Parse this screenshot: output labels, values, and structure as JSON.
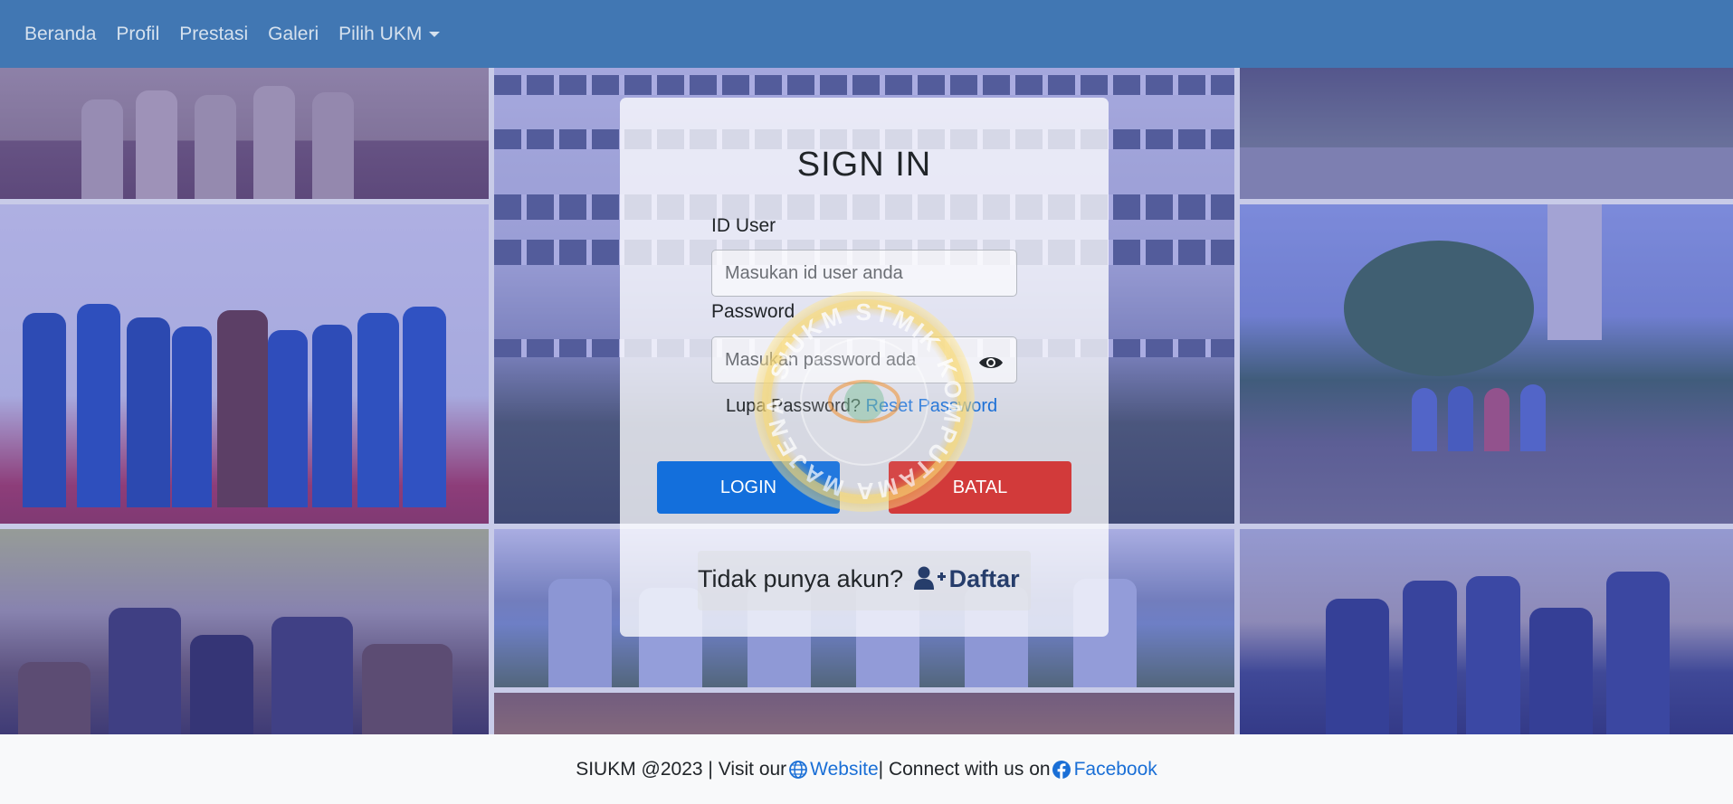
{
  "nav": {
    "items": [
      {
        "label": "Beranda"
      },
      {
        "label": "Profil"
      },
      {
        "label": "Prestasi"
      },
      {
        "label": "Galeri"
      },
      {
        "label": "Pilih UKM"
      }
    ]
  },
  "logo": {
    "text": "SIUKM STMIK KOMPUTAMA MAJENANG"
  },
  "login": {
    "title": "SIGN IN",
    "id_label": "ID User",
    "id_placeholder": "Masukan id user anda",
    "password_label": "Password",
    "password_placeholder": "Masukan password ada",
    "forgot_text": "Lupa Password?",
    "reset_link": "Reset Password",
    "login_button": "LOGIN",
    "cancel_button": "BATAL",
    "no_account_text": "Tidak punya akun?",
    "register_link": "Daftar"
  },
  "footer": {
    "copyright": "SIUKM @2023 | Visit our",
    "website_link": "Website",
    "connect_text": "| Connect with us on",
    "facebook_link": "Facebook"
  },
  "colors": {
    "navbar": "#4177b3",
    "login_button": "#136fdc",
    "cancel_button": "#d23a3a",
    "link": "#1a6fd6"
  }
}
